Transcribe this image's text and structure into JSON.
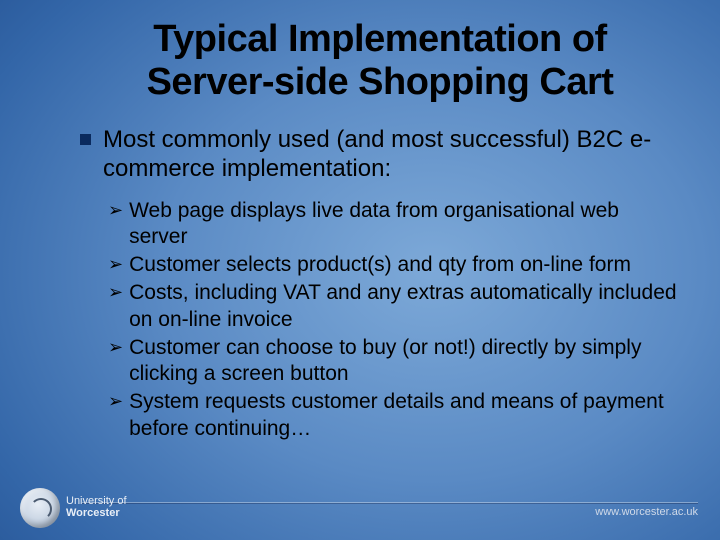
{
  "title": "Typical Implementation of Server-side Shopping Cart",
  "main_point": "Most commonly used (and most successful) B2C e-commerce implementation:",
  "sub_points": [
    "Web page displays live data from organisational web server",
    "Customer selects product(s) and qty from on-line form",
    "Costs, including VAT and any extras automatically included on on-line invoice",
    "Customer can choose to buy (or not!) directly by simply clicking a screen button",
    "System requests customer details and means of payment before continuing…"
  ],
  "logo": {
    "line1": "University of",
    "line2": "Worcester"
  },
  "footer_url": "www.worcester.ac.uk"
}
